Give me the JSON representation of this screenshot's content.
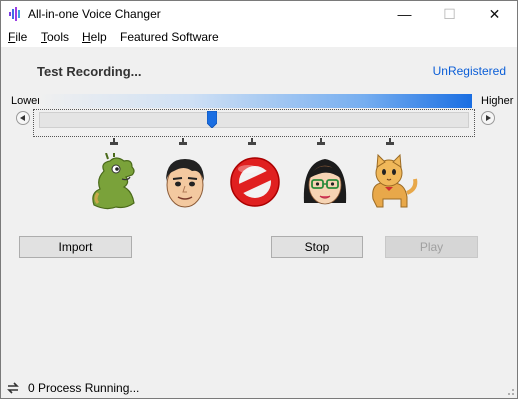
{
  "window": {
    "title": "All-in-one Voice Changer",
    "controls": {
      "minimize": "—",
      "maximize": "☐",
      "close": "✕"
    }
  },
  "menu": {
    "file": "File",
    "tools": "Tools",
    "help": "Help",
    "featured": "Featured Software"
  },
  "status": {
    "title": "Test Recording...",
    "registration_link": "UnRegistered"
  },
  "pitch": {
    "lower_label": "Lower",
    "higher_label": "Higher",
    "tick_count": 5,
    "accent_color": "#1a6ee2"
  },
  "voices": [
    {
      "name": "dragon-icon"
    },
    {
      "name": "boy-face-icon"
    },
    {
      "name": "no-effect-icon"
    },
    {
      "name": "girl-face-icon"
    },
    {
      "name": "cat-icon"
    }
  ],
  "buttons": {
    "import": "Import",
    "stop": "Stop",
    "play": "Play"
  },
  "footer": {
    "process_text": "0 Process Running..."
  }
}
